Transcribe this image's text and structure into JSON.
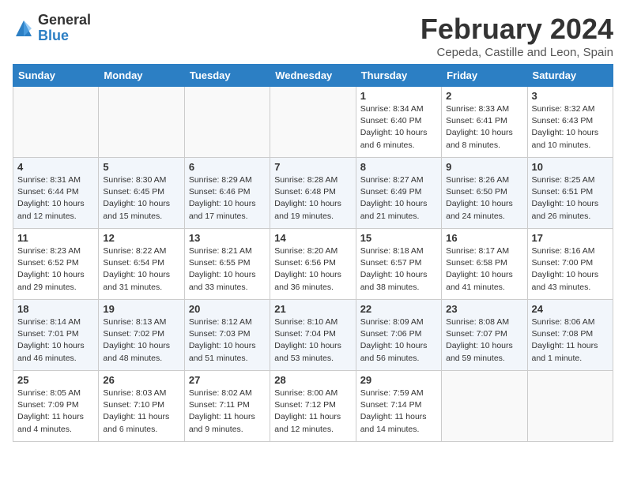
{
  "header": {
    "logo_general": "General",
    "logo_blue": "Blue",
    "month_title": "February 2024",
    "location": "Cepeda, Castille and Leon, Spain"
  },
  "days_of_week": [
    "Sunday",
    "Monday",
    "Tuesday",
    "Wednesday",
    "Thursday",
    "Friday",
    "Saturday"
  ],
  "weeks": [
    [
      {
        "day": "",
        "info": ""
      },
      {
        "day": "",
        "info": ""
      },
      {
        "day": "",
        "info": ""
      },
      {
        "day": "",
        "info": ""
      },
      {
        "day": "1",
        "info": "Sunrise: 8:34 AM\nSunset: 6:40 PM\nDaylight: 10 hours\nand 6 minutes."
      },
      {
        "day": "2",
        "info": "Sunrise: 8:33 AM\nSunset: 6:41 PM\nDaylight: 10 hours\nand 8 minutes."
      },
      {
        "day": "3",
        "info": "Sunrise: 8:32 AM\nSunset: 6:43 PM\nDaylight: 10 hours\nand 10 minutes."
      }
    ],
    [
      {
        "day": "4",
        "info": "Sunrise: 8:31 AM\nSunset: 6:44 PM\nDaylight: 10 hours\nand 12 minutes."
      },
      {
        "day": "5",
        "info": "Sunrise: 8:30 AM\nSunset: 6:45 PM\nDaylight: 10 hours\nand 15 minutes."
      },
      {
        "day": "6",
        "info": "Sunrise: 8:29 AM\nSunset: 6:46 PM\nDaylight: 10 hours\nand 17 minutes."
      },
      {
        "day": "7",
        "info": "Sunrise: 8:28 AM\nSunset: 6:48 PM\nDaylight: 10 hours\nand 19 minutes."
      },
      {
        "day": "8",
        "info": "Sunrise: 8:27 AM\nSunset: 6:49 PM\nDaylight: 10 hours\nand 21 minutes."
      },
      {
        "day": "9",
        "info": "Sunrise: 8:26 AM\nSunset: 6:50 PM\nDaylight: 10 hours\nand 24 minutes."
      },
      {
        "day": "10",
        "info": "Sunrise: 8:25 AM\nSunset: 6:51 PM\nDaylight: 10 hours\nand 26 minutes."
      }
    ],
    [
      {
        "day": "11",
        "info": "Sunrise: 8:23 AM\nSunset: 6:52 PM\nDaylight: 10 hours\nand 29 minutes."
      },
      {
        "day": "12",
        "info": "Sunrise: 8:22 AM\nSunset: 6:54 PM\nDaylight: 10 hours\nand 31 minutes."
      },
      {
        "day": "13",
        "info": "Sunrise: 8:21 AM\nSunset: 6:55 PM\nDaylight: 10 hours\nand 33 minutes."
      },
      {
        "day": "14",
        "info": "Sunrise: 8:20 AM\nSunset: 6:56 PM\nDaylight: 10 hours\nand 36 minutes."
      },
      {
        "day": "15",
        "info": "Sunrise: 8:18 AM\nSunset: 6:57 PM\nDaylight: 10 hours\nand 38 minutes."
      },
      {
        "day": "16",
        "info": "Sunrise: 8:17 AM\nSunset: 6:58 PM\nDaylight: 10 hours\nand 41 minutes."
      },
      {
        "day": "17",
        "info": "Sunrise: 8:16 AM\nSunset: 7:00 PM\nDaylight: 10 hours\nand 43 minutes."
      }
    ],
    [
      {
        "day": "18",
        "info": "Sunrise: 8:14 AM\nSunset: 7:01 PM\nDaylight: 10 hours\nand 46 minutes."
      },
      {
        "day": "19",
        "info": "Sunrise: 8:13 AM\nSunset: 7:02 PM\nDaylight: 10 hours\nand 48 minutes."
      },
      {
        "day": "20",
        "info": "Sunrise: 8:12 AM\nSunset: 7:03 PM\nDaylight: 10 hours\nand 51 minutes."
      },
      {
        "day": "21",
        "info": "Sunrise: 8:10 AM\nSunset: 7:04 PM\nDaylight: 10 hours\nand 53 minutes."
      },
      {
        "day": "22",
        "info": "Sunrise: 8:09 AM\nSunset: 7:06 PM\nDaylight: 10 hours\nand 56 minutes."
      },
      {
        "day": "23",
        "info": "Sunrise: 8:08 AM\nSunset: 7:07 PM\nDaylight: 10 hours\nand 59 minutes."
      },
      {
        "day": "24",
        "info": "Sunrise: 8:06 AM\nSunset: 7:08 PM\nDaylight: 11 hours\nand 1 minute."
      }
    ],
    [
      {
        "day": "25",
        "info": "Sunrise: 8:05 AM\nSunset: 7:09 PM\nDaylight: 11 hours\nand 4 minutes."
      },
      {
        "day": "26",
        "info": "Sunrise: 8:03 AM\nSunset: 7:10 PM\nDaylight: 11 hours\nand 6 minutes."
      },
      {
        "day": "27",
        "info": "Sunrise: 8:02 AM\nSunset: 7:11 PM\nDaylight: 11 hours\nand 9 minutes."
      },
      {
        "day": "28",
        "info": "Sunrise: 8:00 AM\nSunset: 7:12 PM\nDaylight: 11 hours\nand 12 minutes."
      },
      {
        "day": "29",
        "info": "Sunrise: 7:59 AM\nSunset: 7:14 PM\nDaylight: 11 hours\nand 14 minutes."
      },
      {
        "day": "",
        "info": ""
      },
      {
        "day": "",
        "info": ""
      }
    ]
  ]
}
